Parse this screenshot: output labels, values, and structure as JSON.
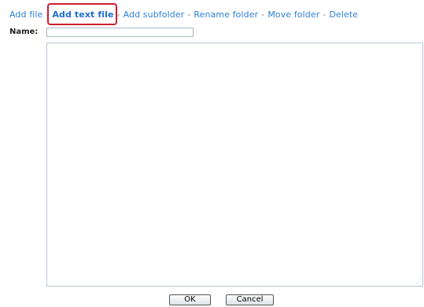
{
  "nav": {
    "items": [
      {
        "label": "Add file"
      },
      {
        "label": "Add text file",
        "active": true
      },
      {
        "label": "Add subfolder"
      },
      {
        "label": "Rename folder"
      },
      {
        "label": "Move folder"
      },
      {
        "label": "Delete"
      }
    ],
    "separator": "-"
  },
  "form": {
    "name_label": "Name:",
    "name_value": "",
    "content_value": ""
  },
  "buttons": {
    "ok_label": "OK",
    "cancel_label": "Cancel"
  },
  "colors": {
    "link": "#2f7fd6",
    "highlight_border": "#cc1f2d",
    "input_border": "#a9b7c7"
  },
  "icons": {
    "resize_grip": "resize-grip-icon"
  }
}
